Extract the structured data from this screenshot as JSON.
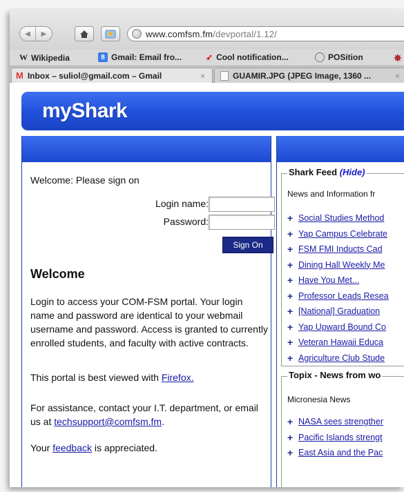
{
  "browser": {
    "url_host": "www.comfsm.fm",
    "url_path": "/devportal/1.12/",
    "bookmarks": [
      {
        "label": "Wikipedia",
        "icon": "wikipedia-icon"
      },
      {
        "label": "Gmail: Email fro...",
        "icon": "google-icon"
      },
      {
        "label": "Cool notification...",
        "icon": "feather-icon"
      },
      {
        "label": "POSition",
        "icon": "position-icon"
      }
    ],
    "tabs": [
      {
        "label": "Inbox – suliol@gmail.com – Gmail",
        "close": "×"
      },
      {
        "label": "GUAMIR.JPG (JPEG Image, 1360 ...",
        "close": "×"
      }
    ]
  },
  "page": {
    "logo": "myShark",
    "login": {
      "welcome_line": "Welcome: Please sign on",
      "login_label": "Login name:",
      "password_label": "Password:",
      "login_value": "",
      "password_value": "",
      "sign_on": "Sign On"
    },
    "welcome": {
      "heading": "Welcome",
      "p1": "Login to access your COM-FSM portal. Your login name and password are identical to your webmail username and password. Access is granted to currently enrolled students, and faculty with active contracts.",
      "p2_prefix": "This portal is best viewed with ",
      "p2_link": "Firefox.",
      "p3_prefix": "For assistance, contact your I.T. department, or email us at ",
      "p3_link": "techsupport@comfsm.fm",
      "p3_suffix": ".",
      "p4_prefix": "Your ",
      "p4_link": "feedback",
      "p4_suffix": " is appreciated."
    },
    "shark_feed": {
      "title": "Shark Feed ",
      "hide": "(Hide)",
      "subtitle": "News and Information fr",
      "items": [
        "Social Studies Method",
        "Yap Campus Celebrate",
        "FSM FMI Inducts Cad",
        "Dining Hall Weekly Me",
        "Have You Met...",
        "Professor Leads Resea",
        "[National] Graduation",
        "Yap Upward Bound Co",
        "Veteran Hawaii Educa",
        "Agriculture Club Stude"
      ]
    },
    "topix": {
      "title": "Topix - News from wo",
      "subtitle": "Micronesia News",
      "items": [
        "NASA sees strengther",
        "Pacific Islands strengt",
        "East Asia and the Pac"
      ]
    }
  }
}
